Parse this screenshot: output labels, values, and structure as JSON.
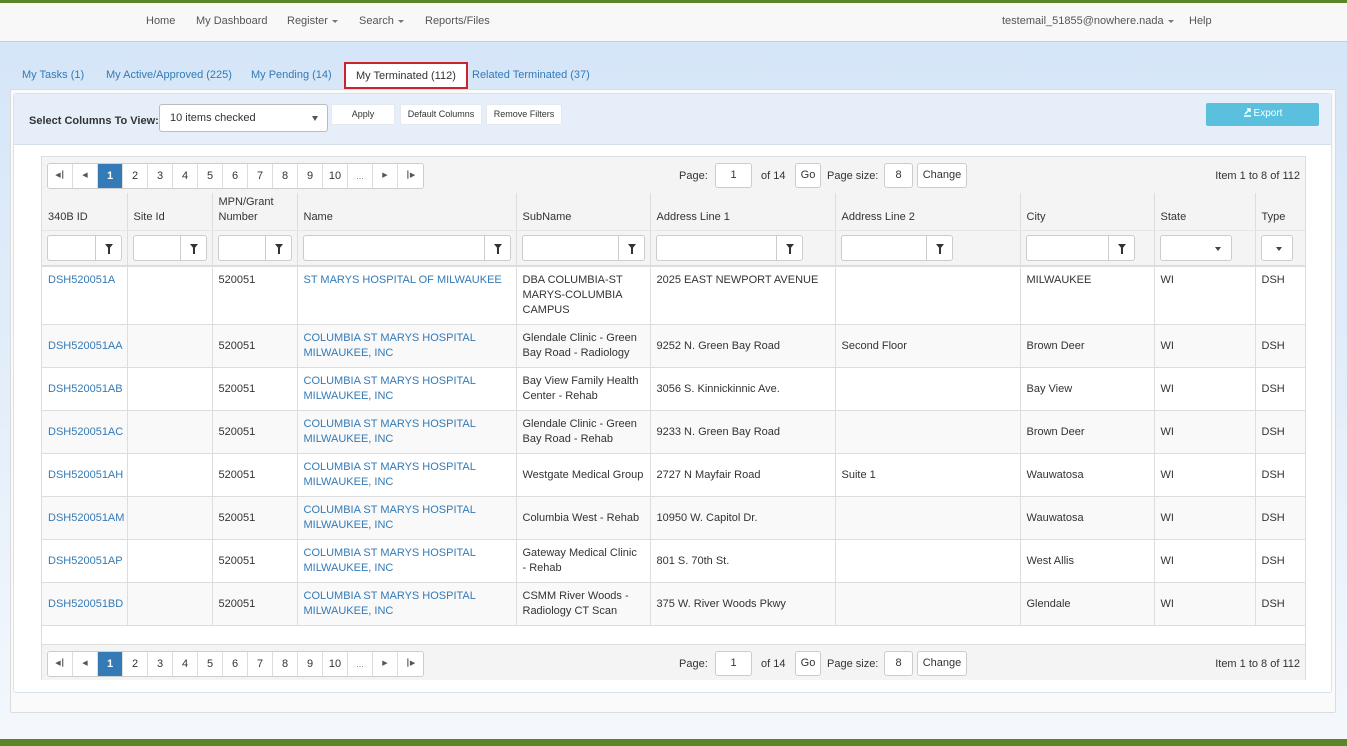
{
  "nav": {
    "items": [
      {
        "label": "Home"
      },
      {
        "label": "My Dashboard"
      },
      {
        "label": "Register"
      },
      {
        "label": "Search"
      },
      {
        "label": "Reports/Files"
      }
    ],
    "user": "testemail_51855@nowhere.nada",
    "help": "Help"
  },
  "tabs": [
    {
      "label": "My Tasks (1)"
    },
    {
      "label": "My Active/Approved (225)"
    },
    {
      "label": "My Pending (14)"
    },
    {
      "label": "My Terminated (112)",
      "active": true
    },
    {
      "label": "Related Terminated (37)"
    }
  ],
  "toolbar": {
    "columns_label": "Select Columns To View:",
    "columns_value": "10 items checked",
    "apply": "Apply",
    "default_columns": "Default Columns",
    "remove_filters": "Remove Filters",
    "export": "Export",
    "export_icon": "export-icon"
  },
  "pager": {
    "pages": [
      "1",
      "2",
      "3",
      "4",
      "5",
      "6",
      "7",
      "8",
      "9",
      "10",
      "..."
    ],
    "current_page": "1",
    "page_label": "Page:",
    "page_value": "1",
    "of_pages": "of 14",
    "go": "Go",
    "page_size_label": "Page size:",
    "page_size_value": "8",
    "change": "Change",
    "item_count": "Item 1 to 8 of 112"
  },
  "table": {
    "columns": [
      "340B ID",
      "Site Id",
      "MPN/Grant Number",
      "Name",
      "SubName",
      "Address Line 1",
      "Address Line 2",
      "City",
      "State",
      "Type"
    ],
    "rows": [
      [
        "DSH520051A",
        "",
        "520051",
        "ST MARYS HOSPITAL OF MILWAUKEE",
        "DBA COLUMBIA-ST MARYS-COLUMBIA CAMPUS",
        "2025 EAST NEWPORT AVENUE",
        "",
        "MILWAUKEE",
        "WI",
        "DSH"
      ],
      [
        "DSH520051AA",
        "",
        "520051",
        "COLUMBIA ST MARYS HOSPITAL MILWAUKEE, INC",
        "Glendale Clinic - Green Bay Road - Radiology",
        "9252 N. Green Bay Road",
        "Second Floor",
        "Brown Deer",
        "WI",
        "DSH"
      ],
      [
        "DSH520051AB",
        "",
        "520051",
        "COLUMBIA ST MARYS HOSPITAL MILWAUKEE, INC",
        "Bay View Family Health Center - Rehab",
        "3056 S. Kinnickinnic Ave.",
        "",
        "Bay View",
        "WI",
        "DSH"
      ],
      [
        "DSH520051AC",
        "",
        "520051",
        "COLUMBIA ST MARYS HOSPITAL MILWAUKEE, INC",
        "Glendale Clinic - Green Bay Road - Rehab",
        "9233 N. Green Bay Road",
        "",
        "Brown Deer",
        "WI",
        "DSH"
      ],
      [
        "DSH520051AH",
        "",
        "520051",
        "COLUMBIA ST MARYS HOSPITAL MILWAUKEE, INC",
        "Westgate Medical Group",
        "2727 N Mayfair Road",
        "Suite 1",
        "Wauwatosa",
        "WI",
        "DSH"
      ],
      [
        "DSH520051AM",
        "",
        "520051",
        "COLUMBIA ST MARYS HOSPITAL MILWAUKEE, INC",
        "Columbia West - Rehab",
        "10950 W. Capitol Dr.",
        "",
        "Wauwatosa",
        "WI",
        "DSH"
      ],
      [
        "DSH520051AP",
        "",
        "520051",
        "COLUMBIA ST MARYS HOSPITAL MILWAUKEE, INC",
        "Gateway Medical Clinic - Rehab",
        "801 S. 70th St.",
        "",
        "West Allis",
        "WI",
        "DSH"
      ],
      [
        "DSH520051BD",
        "",
        "520051",
        "COLUMBIA ST MARYS HOSPITAL MILWAUKEE, INC",
        "CSMM River Woods - Radiology CT Scan",
        "375 W. River Woods Pkwy",
        "",
        "Glendale",
        "WI",
        "DSH"
      ]
    ]
  },
  "colors": {
    "brand_green": "#5a8528",
    "link": "#337ab7",
    "active_tab_border": "#c9232b",
    "export_button": "#5bc0de"
  }
}
